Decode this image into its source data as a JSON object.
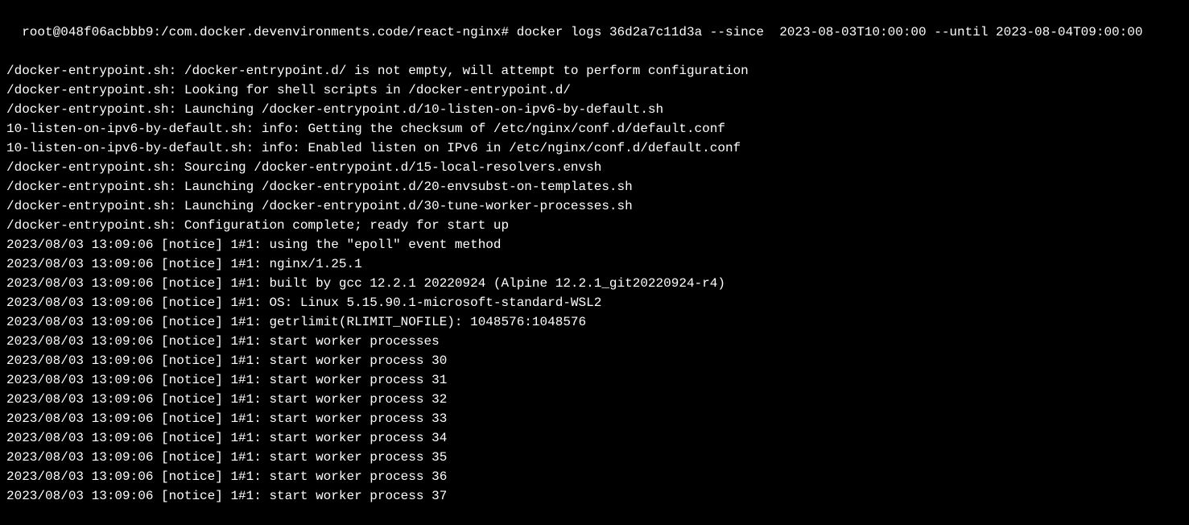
{
  "prompt": {
    "user_host": "root@048f06acbbb9",
    "path": "/com.docker.devenvironments.code/react-nginx",
    "separator": ":",
    "suffix": "#",
    "command": "docker logs 36d2a7c11d3a --since  2023-08-03T10:00:00 --until 2023-08-04T09:00:00"
  },
  "output_lines": [
    "/docker-entrypoint.sh: /docker-entrypoint.d/ is not empty, will attempt to perform configuration",
    "/docker-entrypoint.sh: Looking for shell scripts in /docker-entrypoint.d/",
    "/docker-entrypoint.sh: Launching /docker-entrypoint.d/10-listen-on-ipv6-by-default.sh",
    "10-listen-on-ipv6-by-default.sh: info: Getting the checksum of /etc/nginx/conf.d/default.conf",
    "10-listen-on-ipv6-by-default.sh: info: Enabled listen on IPv6 in /etc/nginx/conf.d/default.conf",
    "/docker-entrypoint.sh: Sourcing /docker-entrypoint.d/15-local-resolvers.envsh",
    "/docker-entrypoint.sh: Launching /docker-entrypoint.d/20-envsubst-on-templates.sh",
    "/docker-entrypoint.sh: Launching /docker-entrypoint.d/30-tune-worker-processes.sh",
    "/docker-entrypoint.sh: Configuration complete; ready for start up",
    "2023/08/03 13:09:06 [notice] 1#1: using the \"epoll\" event method",
    "2023/08/03 13:09:06 [notice] 1#1: nginx/1.25.1",
    "2023/08/03 13:09:06 [notice] 1#1: built by gcc 12.2.1 20220924 (Alpine 12.2.1_git20220924-r4)",
    "2023/08/03 13:09:06 [notice] 1#1: OS: Linux 5.15.90.1-microsoft-standard-WSL2",
    "2023/08/03 13:09:06 [notice] 1#1: getrlimit(RLIMIT_NOFILE): 1048576:1048576",
    "2023/08/03 13:09:06 [notice] 1#1: start worker processes",
    "2023/08/03 13:09:06 [notice] 1#1: start worker process 30",
    "2023/08/03 13:09:06 [notice] 1#1: start worker process 31",
    "2023/08/03 13:09:06 [notice] 1#1: start worker process 32",
    "2023/08/03 13:09:06 [notice] 1#1: start worker process 33",
    "2023/08/03 13:09:06 [notice] 1#1: start worker process 34",
    "2023/08/03 13:09:06 [notice] 1#1: start worker process 35",
    "2023/08/03 13:09:06 [notice] 1#1: start worker process 36",
    "2023/08/03 13:09:06 [notice] 1#1: start worker process 37"
  ]
}
